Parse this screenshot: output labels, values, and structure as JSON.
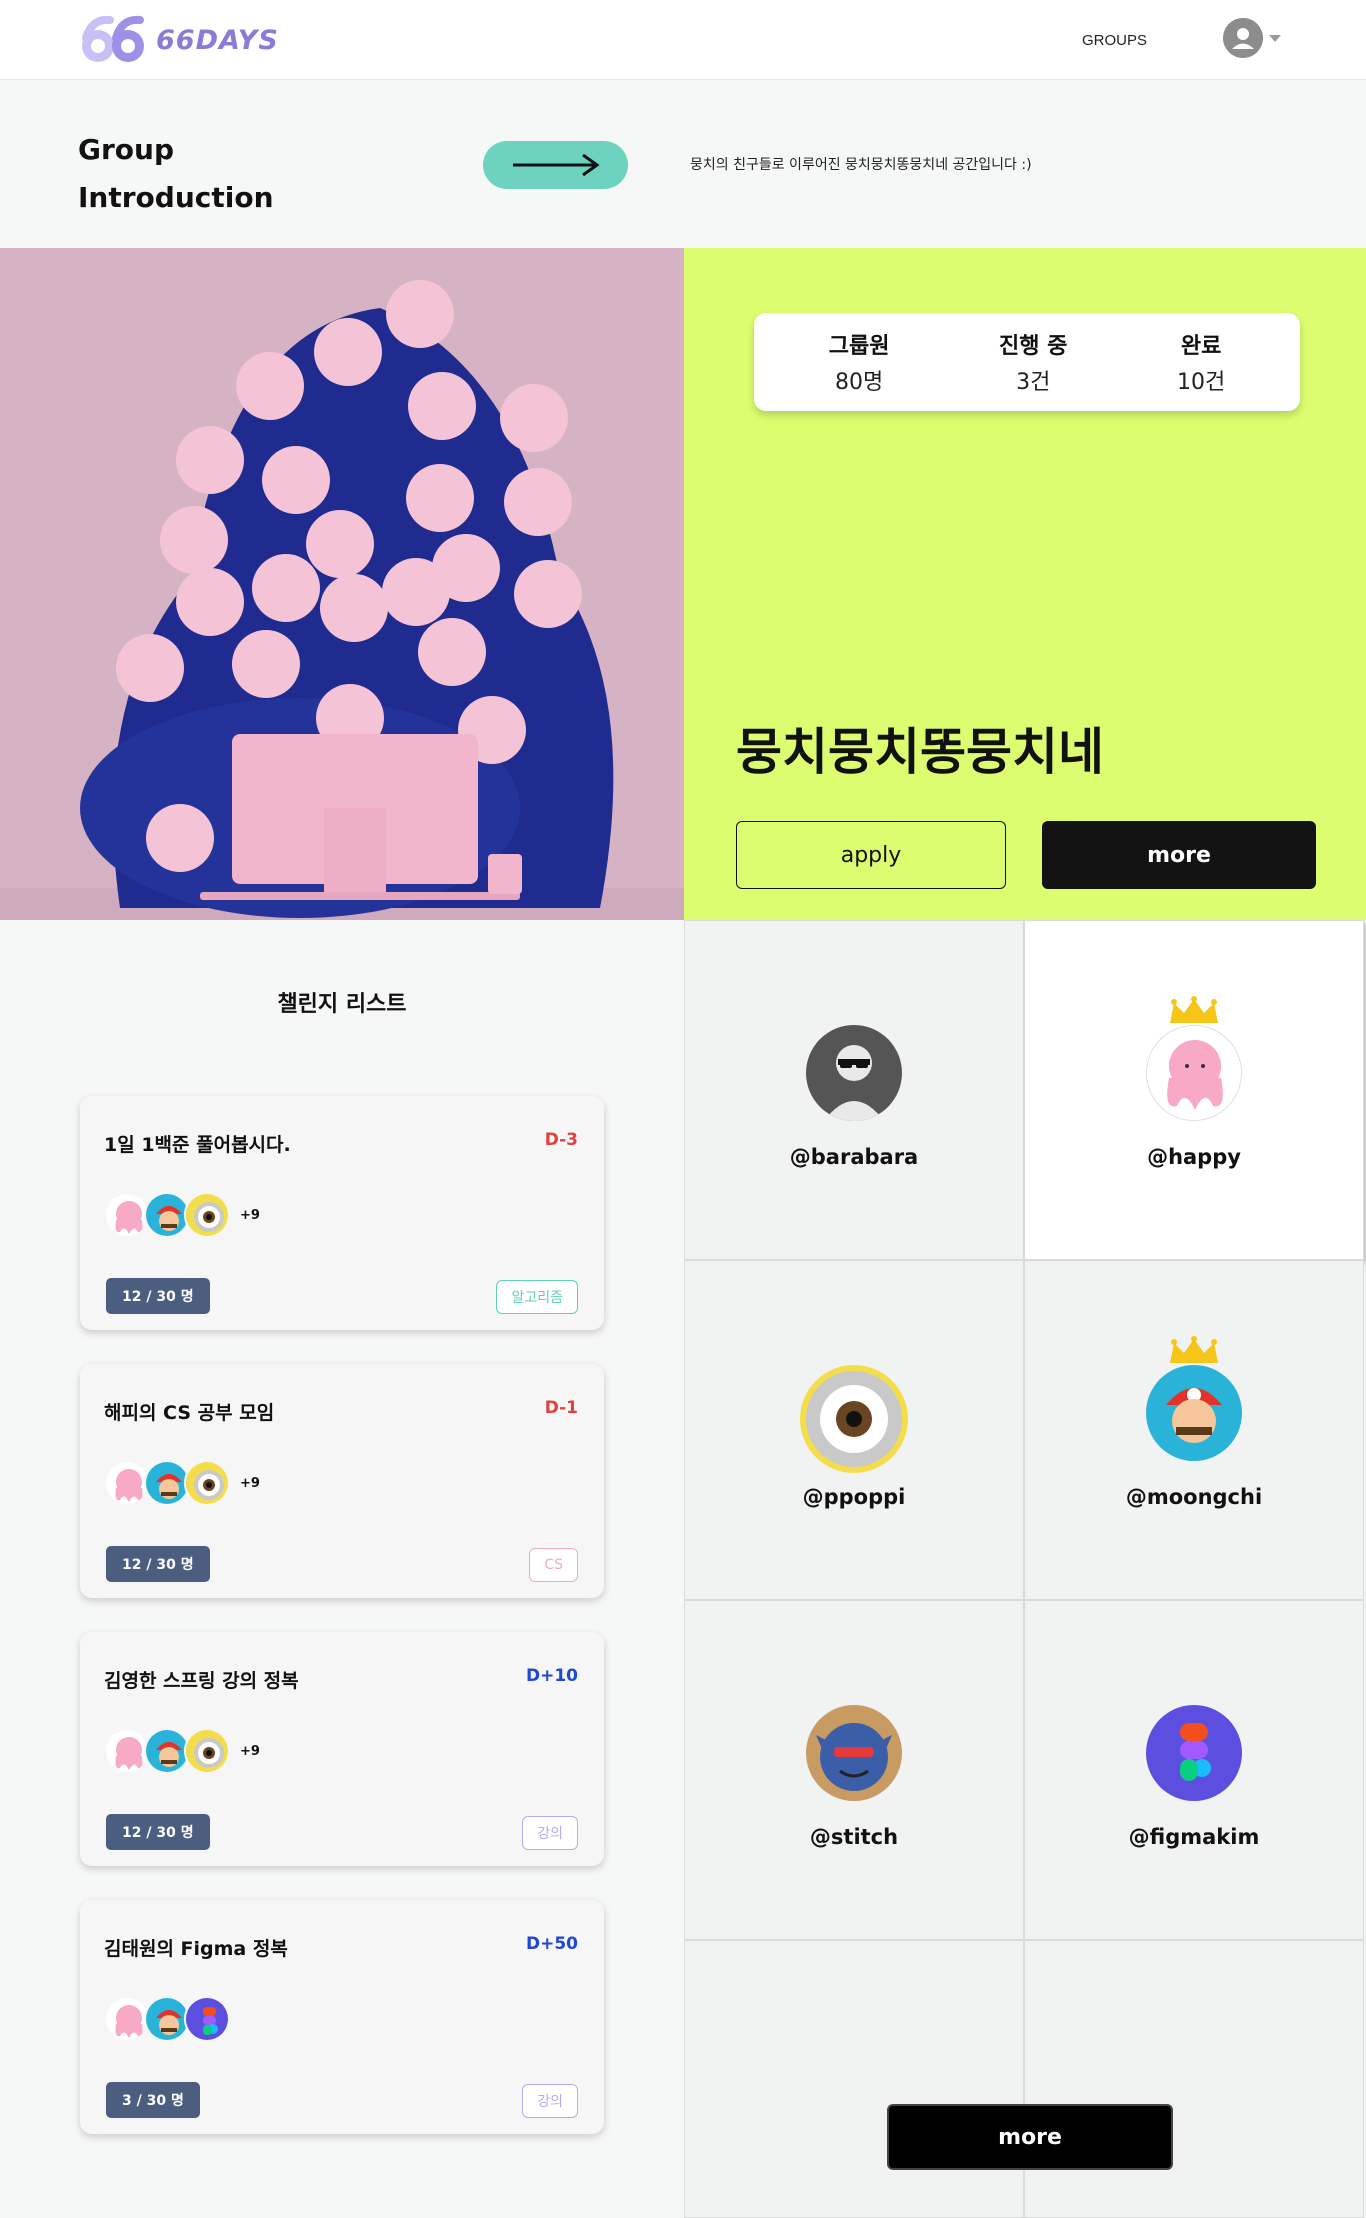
{
  "nav": {
    "logo_text": "66DAYS",
    "groups_label": "GROUPS",
    "avatar_icon": "user-avatar-icon",
    "dropdown_icon": "caret-down-icon"
  },
  "intro": {
    "title_line1": "Group",
    "title_line2": "Introduction",
    "arrow_icon": "arrow-right-icon",
    "description": "뭉치의 친구들로 이루어진 뭉치뭉치똥뭉치네 공간입니다 :)"
  },
  "hero": {
    "stats": [
      {
        "label": "그룹원",
        "value": "80명"
      },
      {
        "label": "진행 중",
        "value": "3건"
      },
      {
        "label": "완료",
        "value": "10건"
      }
    ],
    "group_name": "뭉치뭉치똥뭉치네",
    "apply_label": "apply",
    "more_label": "more"
  },
  "challenges": {
    "title": "챌린지 리스트",
    "items": [
      {
        "title": "1일 1백준 풀어봅시다.",
        "dday": "D-3",
        "dday_color": "#e2403c",
        "extra": "+9",
        "count": "12 / 30 명",
        "tag": "알고리즘",
        "tag_color": "#5fcfb7"
      },
      {
        "title": "해피의 CS 공부 모임",
        "dday": "D-1",
        "dday_color": "#e2403c",
        "extra": "+9",
        "count": "12 / 30 명",
        "tag": "CS",
        "tag_color": "#f2a8c8"
      },
      {
        "title": "김영한 스프링 강의 정복",
        "dday": "D+10",
        "dday_color": "#1f47d6",
        "extra": "+9",
        "count": "12 / 30 명",
        "tag": "강의",
        "tag_color": "#b8a9ec"
      },
      {
        "title": "김태원의 Figma 정복",
        "dday": "D+50",
        "dday_color": "#1f47d6",
        "extra": "",
        "count": "3 / 30 명",
        "tag": "강의",
        "tag_color": "#b8a9ec"
      }
    ]
  },
  "members": {
    "items": [
      {
        "name": "@barabara",
        "crown": false
      },
      {
        "name": "@happy",
        "crown": true
      },
      {
        "name": "@ppoppi",
        "crown": false
      },
      {
        "name": "@moongchi",
        "crown": true
      },
      {
        "name": "@stitch",
        "crown": false
      },
      {
        "name": "@figmakim",
        "crown": false
      }
    ],
    "more_label": "more"
  }
}
